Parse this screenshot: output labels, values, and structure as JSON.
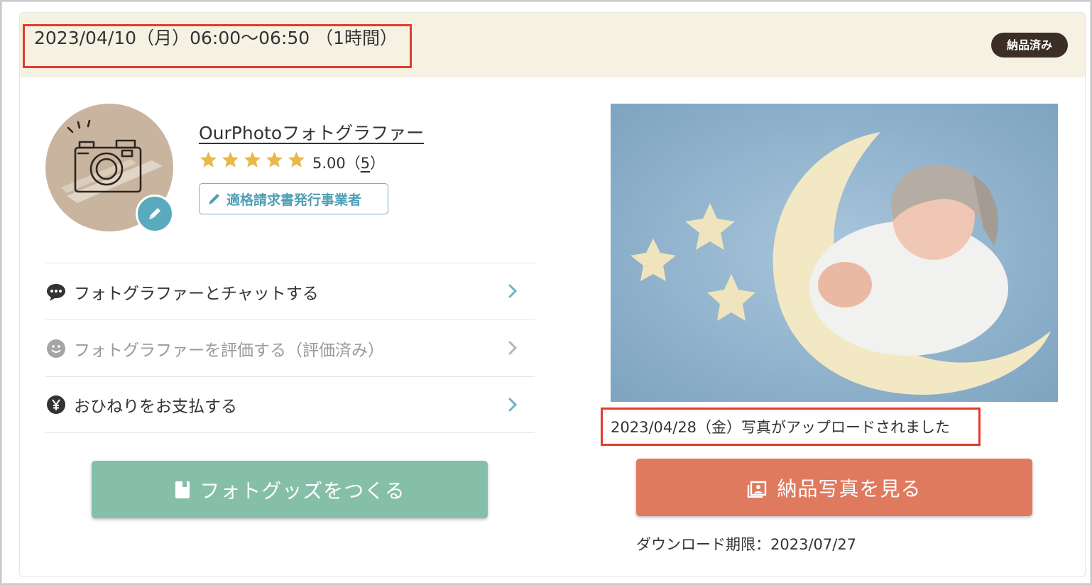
{
  "reservation": {
    "datetime": "2023/04/10（月）06:00〜06:50 （1時間）",
    "status": "納品済み"
  },
  "photographer": {
    "name": "OurPhotoフォトグラファー",
    "rating": "5.00",
    "rating_count_open": "（",
    "rating_count": "5",
    "rating_count_close": "）",
    "stars": 5,
    "invoice_label": "適格請求書発行事業者"
  },
  "menu": {
    "items": [
      {
        "label": "フォトグラファーとチャットする",
        "icon": "chat-bubble-icon",
        "disabled": false
      },
      {
        "label": "フォトグラファーを評価する（評価済み）",
        "icon": "smiley-icon",
        "disabled": true
      },
      {
        "label": "おひねりをお支払する",
        "icon": "yen-coin-icon",
        "disabled": false
      }
    ]
  },
  "buttons": {
    "goods_label": "フォトグッズをつくる",
    "view_label": "納品写真を見る"
  },
  "delivery": {
    "uploaded_text": "2023/04/28（金）写真がアップロードされました",
    "download_deadline": "ダウンロード期限：2023/07/27"
  },
  "colors": {
    "header_bg": "#f5f2e3",
    "status_badge": "#3a2e25",
    "accent_blue": "#5aaabf",
    "goods_button": "#86bfa9",
    "view_button": "#e07a5f",
    "highlight_box": "#e33b2b",
    "star": "#e8b84a"
  }
}
